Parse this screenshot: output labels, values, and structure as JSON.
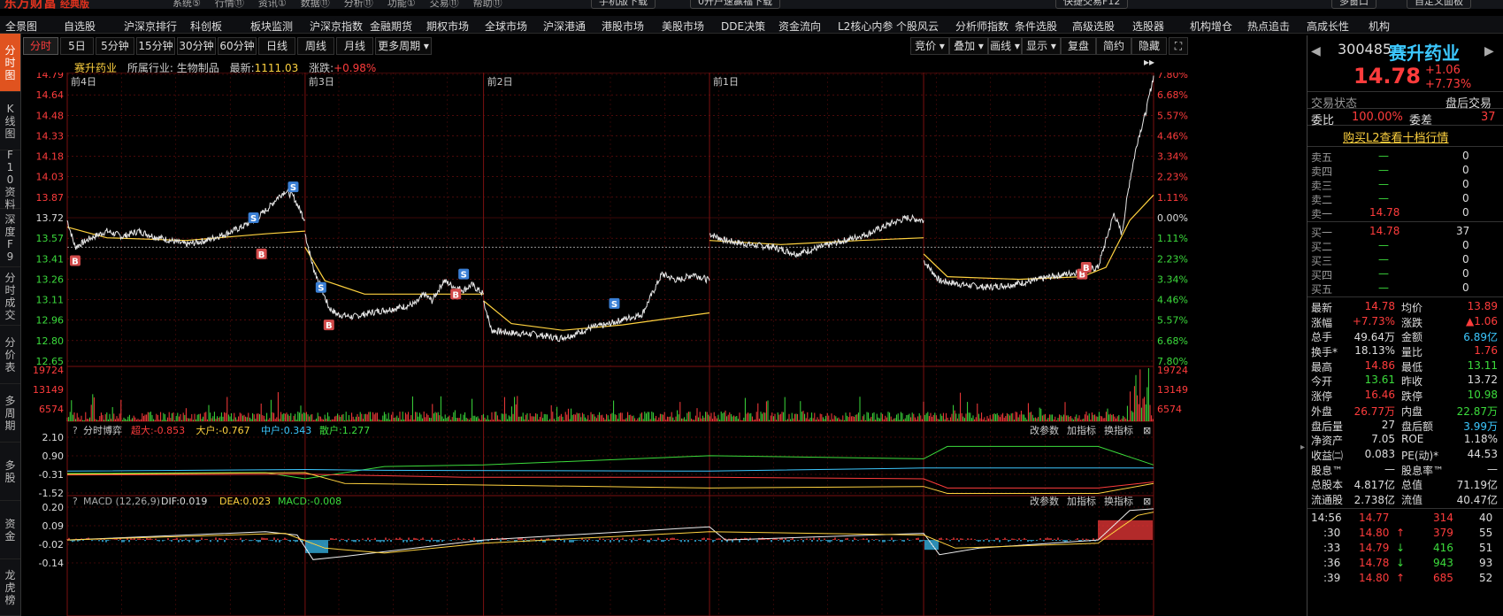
{
  "topbar": {
    "brand": "东方财富",
    "brand_sub": "经典版",
    "menus": [
      "系统⑤",
      "行情⑪",
      "资讯①",
      "数据⑪",
      "分析⑪",
      "功能①",
      "交易⑪",
      "帮助⑪"
    ],
    "mobile": "手机版下载",
    "open_account": "0开户速赢福下载",
    "quick_trade": "快捷交易F12",
    "multi_screen": "多窗口",
    "custom": "自定义面板"
  },
  "nav": [
    "全景图",
    "自选股",
    "沪深京排行",
    "科创板",
    "板块监测",
    "沪深京指数",
    "金融期货",
    "期权市场",
    "全球市场",
    "沪深港通",
    "港股市场",
    "美股市场",
    "DDE决策",
    "资金流向",
    "L2核心内参",
    "个股风云",
    "分析师指数",
    "条件选股",
    "高级选股",
    "选股器",
    "机构增仓",
    "热点追击",
    "高成长性",
    "机构"
  ],
  "sidebar": [
    "分时图",
    "K线图",
    "F10资料",
    "深度F9",
    "分时成交",
    "分价表",
    "多周期",
    "多股",
    "资金",
    "龙虎榜"
  ],
  "tabs": [
    "分时",
    "5日",
    "5分钟",
    "15分钟",
    "30分钟",
    "60分钟",
    "日线",
    "周线",
    "月线",
    "更多周期"
  ],
  "right_tabs": [
    "竞价",
    "叠加",
    "画线",
    "显示",
    "复盘",
    "简约",
    "隐藏"
  ],
  "info": {
    "name": "赛升药业",
    "industry_label": "所属行业:",
    "industry": "生物制品",
    "latest_label": "最新:",
    "latest": "1111.03",
    "change_label": "涨跌:",
    "change": "+0.98%"
  },
  "chart_data": {
    "type": "line",
    "day_labels": [
      "前4日",
      "前3日",
      "前2日",
      "前1日"
    ],
    "y_left": [
      "14.79",
      "14.64",
      "14.48",
      "14.33",
      "14.18",
      "14.03",
      "13.87",
      "13.72",
      "13.57",
      "13.41",
      "13.26",
      "13.11",
      "12.96",
      "12.80",
      "12.65"
    ],
    "y_right": [
      "7.80%",
      "6.68%",
      "5.57%",
      "4.46%",
      "3.34%",
      "2.23%",
      "1.11%",
      "0.00%",
      "1.11%",
      "2.23%",
      "3.34%",
      "4.46%",
      "5.57%",
      "6.68%",
      "7.80%"
    ],
    "ylim": [
      12.65,
      14.79
    ],
    "prev_close": 13.72,
    "day_paths": [
      {
        "price": [
          [
            0,
            13.7
          ],
          [
            2,
            13.5
          ],
          [
            6,
            13.57
          ],
          [
            10,
            13.62
          ],
          [
            14,
            13.58
          ],
          [
            18,
            13.62
          ],
          [
            22,
            13.58
          ],
          [
            26,
            13.55
          ],
          [
            30,
            13.52
          ],
          [
            35,
            13.55
          ],
          [
            40,
            13.6
          ],
          [
            44,
            13.65
          ],
          [
            48,
            13.72
          ],
          [
            51,
            13.8
          ],
          [
            53,
            13.87
          ],
          [
            55,
            13.92
          ],
          [
            57,
            13.88
          ],
          [
            60,
            13.7
          ]
        ],
        "avg": [
          [
            0,
            13.65
          ],
          [
            10,
            13.57
          ],
          [
            30,
            13.55
          ],
          [
            50,
            13.6
          ],
          [
            60,
            13.62
          ]
        ]
      },
      {
        "price": [
          [
            60,
            13.6
          ],
          [
            62,
            13.35
          ],
          [
            64,
            13.2
          ],
          [
            66,
            13.05
          ],
          [
            68,
            13.0
          ],
          [
            72,
            12.98
          ],
          [
            78,
            13.02
          ],
          [
            84,
            13.05
          ],
          [
            88,
            13.08
          ],
          [
            90,
            13.15
          ],
          [
            92,
            13.1
          ],
          [
            95,
            13.25
          ],
          [
            98,
            13.2
          ],
          [
            100,
            13.18
          ],
          [
            102,
            13.22
          ],
          [
            105,
            13.15
          ]
        ],
        "avg": [
          [
            60,
            13.5
          ],
          [
            65,
            13.25
          ],
          [
            75,
            13.15
          ],
          [
            90,
            13.15
          ],
          [
            105,
            13.15
          ]
        ]
      },
      {
        "price": [
          [
            105,
            13.1
          ],
          [
            107,
            12.88
          ],
          [
            112,
            12.86
          ],
          [
            118,
            12.85
          ],
          [
            124,
            12.82
          ],
          [
            128,
            12.85
          ],
          [
            132,
            12.9
          ],
          [
            136,
            12.92
          ],
          [
            140,
            12.96
          ],
          [
            145,
            13.0
          ],
          [
            150,
            13.3
          ],
          [
            154,
            13.25
          ],
          [
            158,
            13.3
          ],
          [
            162,
            13.25
          ]
        ],
        "avg": [
          [
            105,
            13.1
          ],
          [
            112,
            12.93
          ],
          [
            125,
            12.88
          ],
          [
            140,
            12.92
          ],
          [
            162,
            13.01
          ]
        ]
      },
      {
        "price": [
          [
            162,
            13.6
          ],
          [
            166,
            13.55
          ],
          [
            172,
            13.52
          ],
          [
            178,
            13.5
          ],
          [
            184,
            13.45
          ],
          [
            190,
            13.5
          ],
          [
            196,
            13.55
          ],
          [
            202,
            13.6
          ],
          [
            208,
            13.68
          ],
          [
            212,
            13.72
          ],
          [
            216,
            13.7
          ]
        ],
        "avg": [
          [
            162,
            13.55
          ],
          [
            180,
            13.52
          ],
          [
            200,
            13.55
          ],
          [
            216,
            13.57
          ]
        ]
      },
      {
        "price": [
          [
            216,
            13.4
          ],
          [
            220,
            13.25
          ],
          [
            226,
            13.22
          ],
          [
            232,
            13.2
          ],
          [
            238,
            13.22
          ],
          [
            244,
            13.25
          ],
          [
            248,
            13.28
          ],
          [
            252,
            13.3
          ],
          [
            256,
            13.32
          ],
          [
            260,
            13.35
          ],
          [
            262,
            13.55
          ],
          [
            264,
            13.75
          ],
          [
            266,
            13.6
          ],
          [
            268,
            14.0
          ],
          [
            270,
            14.3
          ],
          [
            272,
            14.5
          ],
          [
            274,
            14.78
          ]
        ],
        "avg": [
          [
            216,
            13.45
          ],
          [
            222,
            13.28
          ],
          [
            240,
            13.26
          ],
          [
            256,
            13.28
          ],
          [
            262,
            13.35
          ],
          [
            268,
            13.7
          ],
          [
            274,
            13.89
          ]
        ]
      }
    ],
    "signals": [
      {
        "t": "B",
        "x": 2,
        "y": 13.4
      },
      {
        "t": "S",
        "x": 47,
        "y": 13.72
      },
      {
        "t": "B",
        "x": 49,
        "y": 13.45
      },
      {
        "t": "S",
        "x": 57,
        "y": 13.95
      },
      {
        "t": "S",
        "x": 64,
        "y": 13.2
      },
      {
        "t": "B",
        "x": 66,
        "y": 12.92
      },
      {
        "t": "S",
        "x": 100,
        "y": 13.3
      },
      {
        "t": "B",
        "x": 98,
        "y": 13.15
      },
      {
        "t": "S",
        "x": 138,
        "y": 13.08
      },
      {
        "t": "B",
        "x": 256,
        "y": 13.3
      },
      {
        "t": "B",
        "x": 257,
        "y": 13.35
      }
    ],
    "volume_labels": [
      "19724",
      "13149",
      "6574"
    ],
    "boyi": {
      "title": "分时博弈",
      "items": [
        {
          "label": "超大:-0.853",
          "color": "#ff3c3c"
        },
        {
          "label": "大户:-0.767",
          "color": "#ffd23f"
        },
        {
          "label": "中户:0.343",
          "color": "#3cc8ff"
        },
        {
          "label": "散户:1.277",
          "color": "#3cdc3c"
        }
      ],
      "y": [
        "2.10",
        "0.90",
        "-0.31",
        "-1.52"
      ],
      "btns": [
        "改参数",
        "加指标",
        "换指标"
      ]
    },
    "macd": {
      "title": "MACD (12,26,9)",
      "dif": "DIF:0.019",
      "dea": "DEA:0.023",
      "macd": "MACD:-0.008",
      "y": [
        "0.20",
        "0.09",
        "-0.02",
        "-0.14"
      ],
      "btns": [
        "改参数",
        "加指标",
        "换指标"
      ]
    }
  },
  "quote": {
    "code": "300485",
    "name": "赛升药业",
    "price": "14.78",
    "chg": "+1.06",
    "pct": "+7.73%",
    "state_label": "交易状态",
    "state": "盘后交易",
    "weibi_label": "委比",
    "weibi": "100.00%",
    "weicha_label": "委差",
    "weicha": "37",
    "l2": "购买L2查看十档行情",
    "sells": [
      {
        "n": "卖五",
        "p": "—",
        "v": "0"
      },
      {
        "n": "卖四",
        "p": "—",
        "v": "0"
      },
      {
        "n": "卖三",
        "p": "—",
        "v": "0"
      },
      {
        "n": "卖二",
        "p": "—",
        "v": "0"
      },
      {
        "n": "卖一",
        "p": "14.78",
        "v": "0"
      }
    ],
    "buys": [
      {
        "n": "买一",
        "p": "14.78",
        "v": "37"
      },
      {
        "n": "买二",
        "p": "—",
        "v": "0"
      },
      {
        "n": "买三",
        "p": "—",
        "v": "0"
      },
      {
        "n": "买四",
        "p": "—",
        "v": "0"
      },
      {
        "n": "买五",
        "p": "—",
        "v": "0"
      }
    ],
    "stats": [
      {
        "a": "最新",
        "av": "14.78",
        "ac": "red",
        "b": "均价",
        "bv": "13.89",
        "bc": "red"
      },
      {
        "a": "涨幅",
        "av": "+7.73%",
        "ac": "red",
        "b": "涨跌",
        "bv": "▲1.06",
        "bc": "red"
      },
      {
        "a": "总手",
        "av": "49.64万",
        "ac": "wht",
        "b": "金额",
        "bv": "6.89亿",
        "bc": "cyan"
      },
      {
        "a": "换手*",
        "av": "18.13%",
        "ac": "wht",
        "b": "量比",
        "bv": "1.76",
        "bc": "red"
      },
      {
        "a": "最高",
        "av": "14.86",
        "ac": "red",
        "b": "最低",
        "bv": "13.11",
        "bc": "green"
      },
      {
        "a": "今开",
        "av": "13.61",
        "ac": "green",
        "b": "昨收",
        "bv": "13.72",
        "bc": "wht"
      },
      {
        "a": "涨停",
        "av": "16.46",
        "ac": "red",
        "b": "跌停",
        "bv": "10.98",
        "bc": "green"
      },
      {
        "a": "外盘",
        "av": "26.77万",
        "ac": "red",
        "b": "内盘",
        "bv": "22.87万",
        "bc": "green"
      },
      {
        "a": "盘后量",
        "av": "27",
        "ac": "wht",
        "b": "盘后额",
        "bv": "3.99万",
        "bc": "cyan"
      },
      {
        "a": "净资产",
        "av": "7.05",
        "ac": "wht",
        "b": "ROE",
        "bv": "1.18%",
        "bc": "wht"
      },
      {
        "a": "收益㈡",
        "av": "0.083",
        "ac": "wht",
        "b": "PE(动)*",
        "bv": "44.53",
        "bc": "wht"
      },
      {
        "a": "股息™",
        "av": "—",
        "ac": "wht",
        "b": "股息率™",
        "bv": "—",
        "bc": "wht"
      },
      {
        "a": "总股本",
        "av": "4.817亿",
        "ac": "wht",
        "b": "总值",
        "bv": "71.19亿",
        "bc": "wht"
      },
      {
        "a": "流通股",
        "av": "2.738亿",
        "ac": "wht",
        "b": "流值",
        "bv": "40.47亿",
        "bc": "wht"
      }
    ],
    "ticks": [
      {
        "t": "14:56",
        "p": "14.77",
        "v": "314",
        "n": "40",
        "dir": ""
      },
      {
        "t": ":30",
        "p": "14.80",
        "v": "379",
        "n": "55",
        "dir": "↑"
      },
      {
        "t": ":33",
        "p": "14.79",
        "v": "416",
        "n": "51",
        "dir": "↓"
      },
      {
        "t": ":36",
        "p": "14.78",
        "v": "943",
        "n": "93",
        "dir": "↓"
      },
      {
        "t": ":39",
        "p": "14.80",
        "v": "685",
        "n": "52",
        "dir": "↑"
      }
    ]
  },
  "colors": {
    "up": "#ff3c3c",
    "down": "#3cdc3c",
    "avg": "#ffd23f",
    "price": "#e8e8e8",
    "grid": "#7a1010",
    "accent": "#3cc8ff"
  }
}
